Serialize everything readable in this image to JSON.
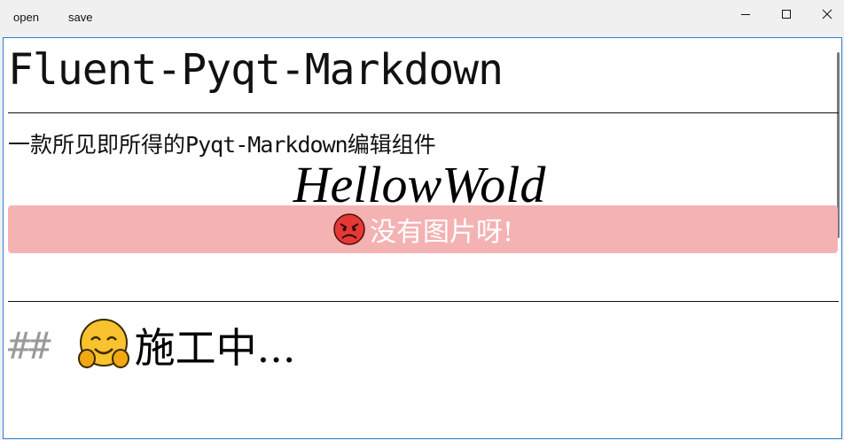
{
  "menu": {
    "open_label": "open",
    "save_label": "save"
  },
  "window_controls": [
    "minimize",
    "maximize",
    "close"
  ],
  "editor": {
    "heading1": "Fluent-Pyqt-Markdown",
    "subtitle_cn_prefix": "一款所见即所得的",
    "subtitle_mono": "Pyqt-Markdown",
    "subtitle_cn_suffix": "编辑组件",
    "hello": "HellowWold",
    "missing_image_text": "没有图片呀!",
    "missing_image_icon": "angry-face-icon",
    "missing_image_bg": "#f4b2b3",
    "heading2_marker": "##",
    "heading2_icon": "hugging-face-icon",
    "heading2_text": "施工中..."
  }
}
